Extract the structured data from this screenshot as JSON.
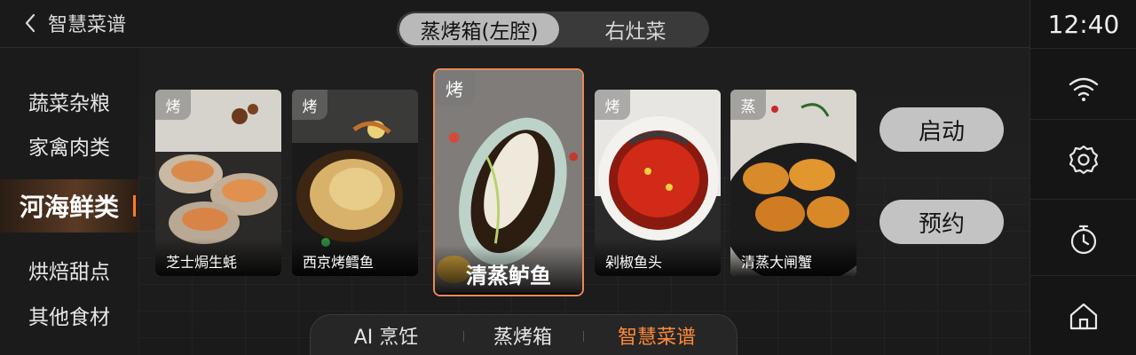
{
  "header": {
    "back_label": "智慧菜谱",
    "mode_tabs": [
      "蒸烤箱(左腔)",
      "右灶菜"
    ]
  },
  "categories": [
    "蔬菜杂粮",
    "家禽肉类",
    "河海鲜类",
    "烘焙甜点",
    "其他食材"
  ],
  "active_category": "河海鲜类",
  "dishes": [
    {
      "tag": "烤",
      "name": "芝士焗生蚝"
    },
    {
      "tag": "烤",
      "name": "西京烤鳕鱼"
    },
    {
      "tag": "烤",
      "name": "清蒸鲈鱼"
    },
    {
      "tag": "烤",
      "name": "剁椒鱼头"
    },
    {
      "tag": "蒸",
      "name": "清蒸大闸蟹"
    }
  ],
  "selected_dish": "清蒸鲈鱼",
  "actions": {
    "start": "启动",
    "schedule": "预约"
  },
  "bottom_nav": [
    "AI 烹饪",
    "蒸烤箱",
    "智慧菜谱"
  ],
  "bottom_nav_active": "智慧菜谱",
  "status": {
    "time": "12:40"
  },
  "right_icons": [
    "wifi-icon",
    "settings-icon",
    "timer-icon",
    "home-icon"
  ],
  "colors": {
    "accent": "#ff8a3a",
    "selected_border": "#e58a5a",
    "tab_active_bg": "#b9b9b9"
  }
}
